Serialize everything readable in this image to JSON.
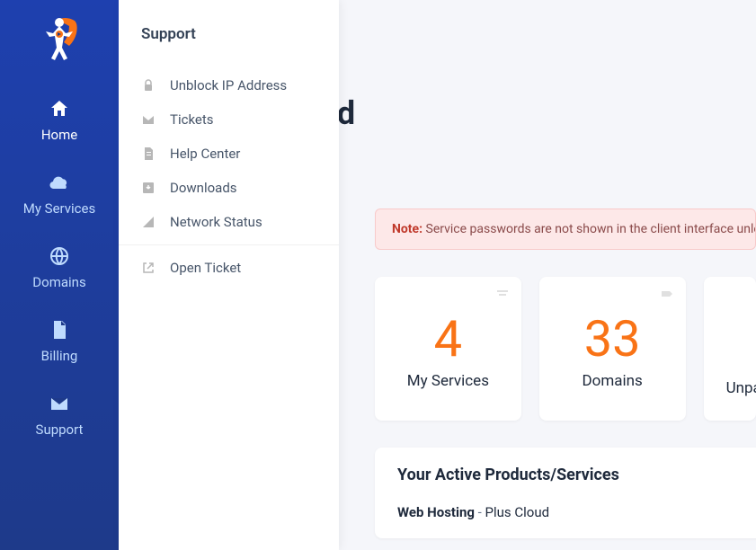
{
  "sidebar": {
    "items": [
      {
        "label": "Home"
      },
      {
        "label": "My Services"
      },
      {
        "label": "Domains"
      },
      {
        "label": "Billing"
      },
      {
        "label": "Support"
      }
    ]
  },
  "submenu": {
    "title": "Support",
    "section1": [
      {
        "label": "Unblock IP Address"
      },
      {
        "label": "Tickets"
      },
      {
        "label": "Help Center"
      },
      {
        "label": "Downloads"
      },
      {
        "label": "Network Status"
      }
    ],
    "section2": [
      {
        "label": "Open Ticket"
      }
    ]
  },
  "page": {
    "title_fragment": "rd"
  },
  "alert": {
    "prefix": "Note:",
    "text": " Service passwords are not shown in the client interface unless"
  },
  "cards": [
    {
      "number": "4",
      "label": "My Services"
    },
    {
      "number": "33",
      "label": "Domains"
    },
    {
      "number": "",
      "label": "Unpaid"
    }
  ],
  "panel": {
    "title": "Your Active Products/Services",
    "products": [
      {
        "name": "Web Hosting",
        "plan": "Plus Cloud"
      }
    ]
  }
}
